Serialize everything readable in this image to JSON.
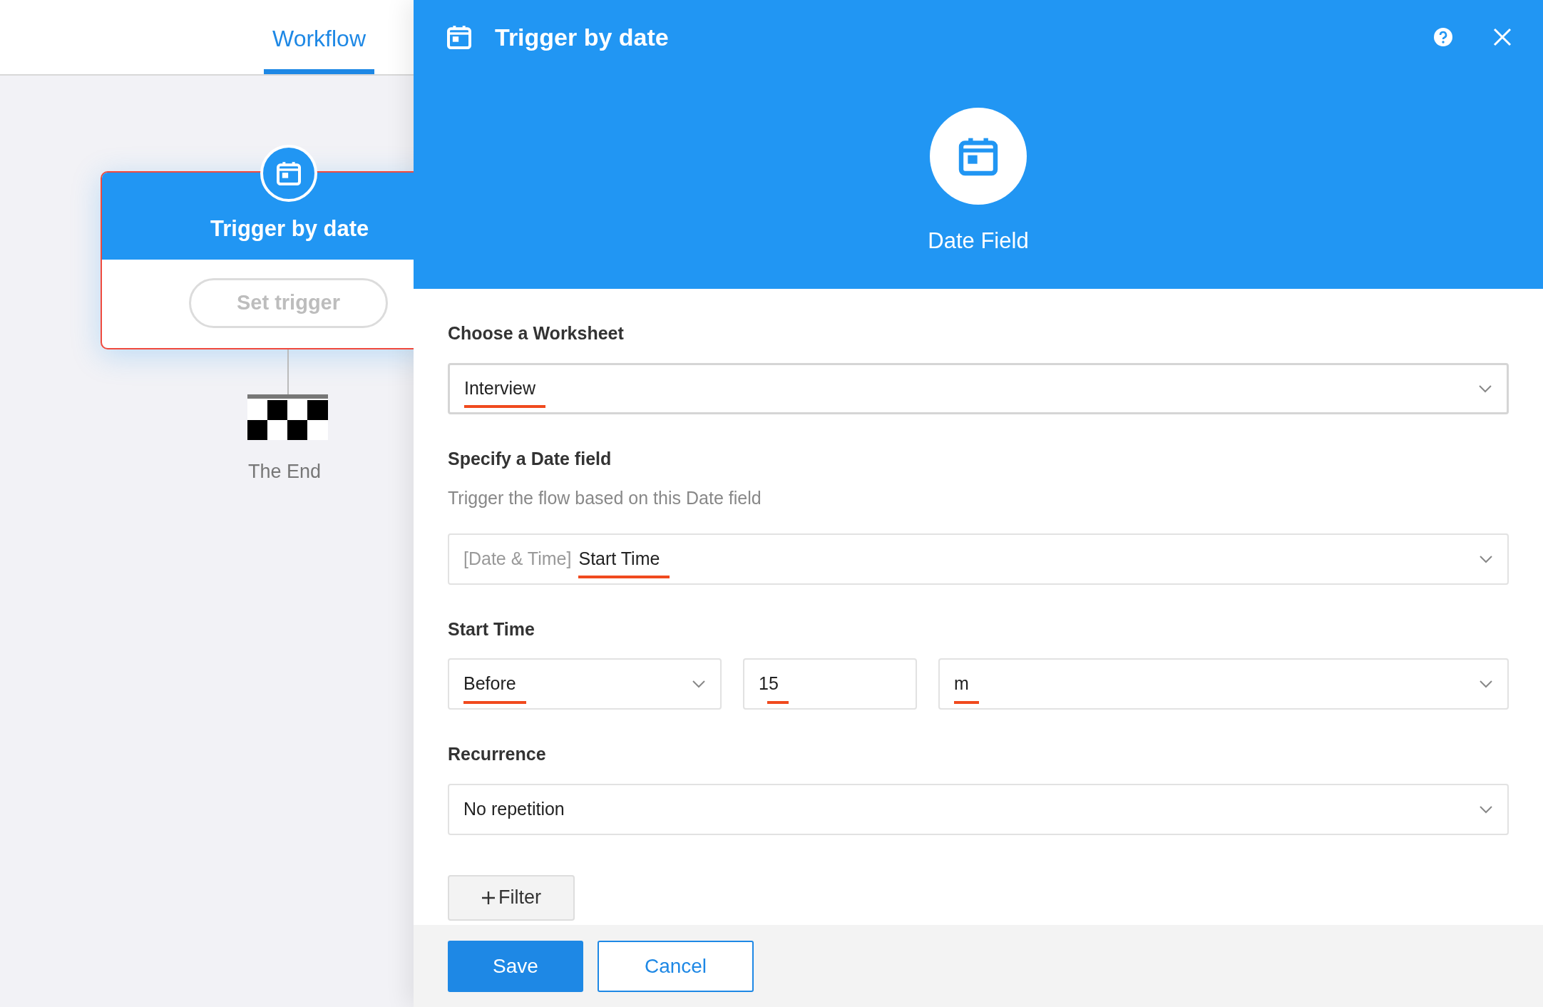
{
  "tabs": [
    {
      "label": "Workflow",
      "selected": true
    }
  ],
  "canvas": {
    "node": {
      "title": "Trigger by date",
      "button": "Set trigger",
      "selected": true
    },
    "end": {
      "label": "The End"
    }
  },
  "panel": {
    "title": "Trigger by date",
    "type": {
      "label": "Date Field"
    },
    "sections": [
      {
        "label": "Choose a Worksheet",
        "controls": [
          {
            "kind": "select",
            "value": "Interview",
            "underlined": true,
            "emphasized": true
          }
        ]
      },
      {
        "label": "Specify a Date field",
        "hint": "Trigger the flow based on this Date field",
        "controls": [
          {
            "kind": "select",
            "prefix": "[Date & Time]",
            "value": "Start Time",
            "underlined": true
          }
        ]
      },
      {
        "label": "Start Time",
        "controls": [
          {
            "kind": "select",
            "value": "Before",
            "underlined": true
          },
          {
            "kind": "input",
            "value": "15",
            "underlined": true
          },
          {
            "kind": "select",
            "value": "m",
            "underlined": true
          }
        ]
      },
      {
        "label": "Recurrence",
        "controls": [
          {
            "kind": "select",
            "value": "No repetition",
            "underlined": false
          }
        ]
      }
    ],
    "filter_button": "Filter",
    "buttons": [
      {
        "label": "Save",
        "kind": "primary"
      },
      {
        "label": "Cancel",
        "kind": "secondary"
      }
    ]
  }
}
